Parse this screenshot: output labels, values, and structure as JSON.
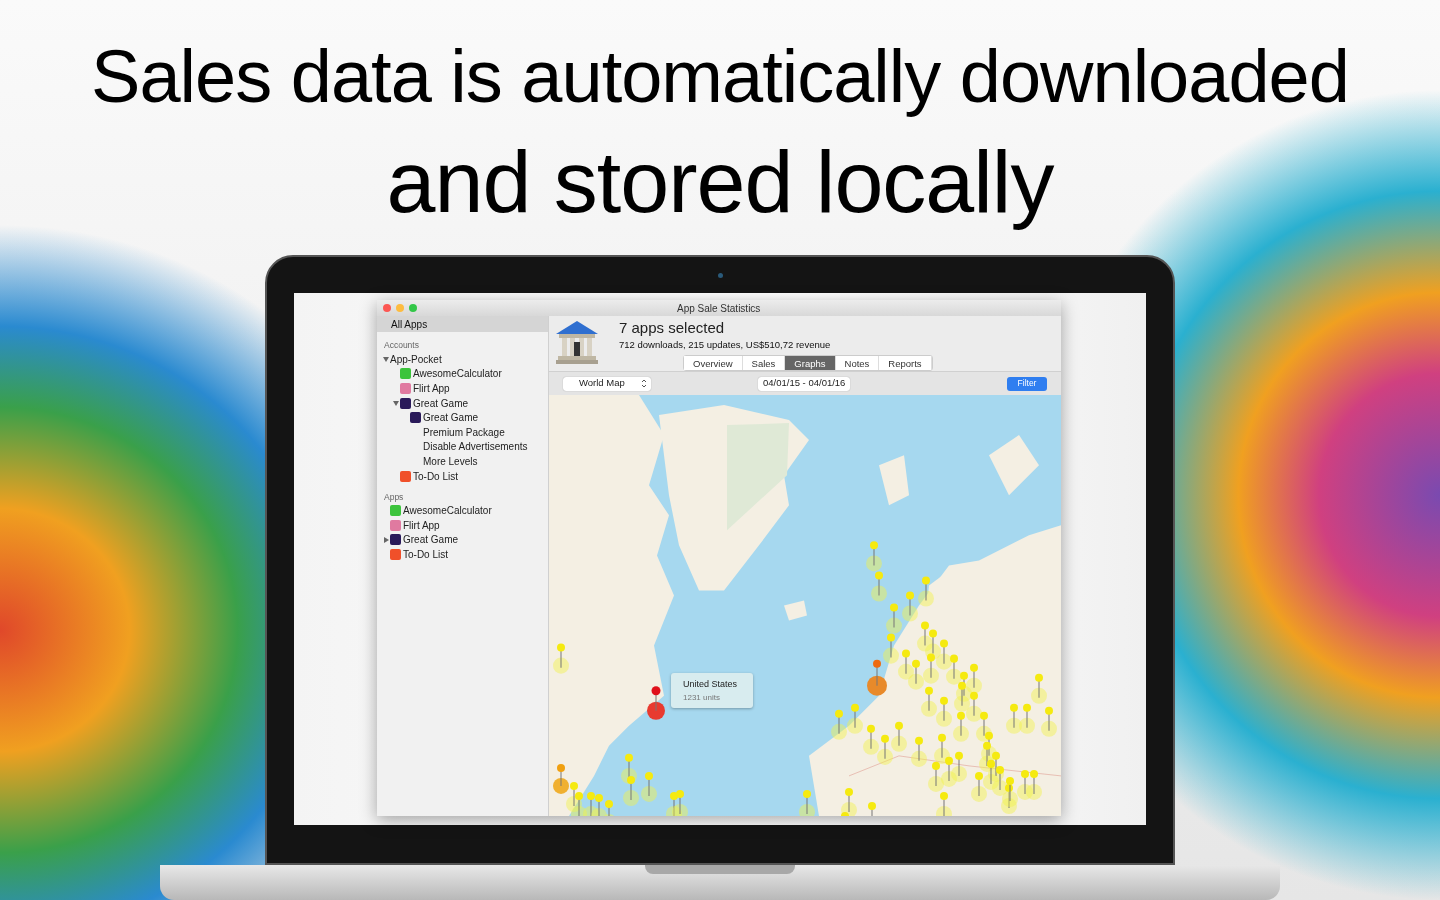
{
  "headline": [
    "Sales data is automatically downloaded",
    "and stored locally"
  ],
  "window": {
    "title": "App Sale Statistics"
  },
  "sidebar": {
    "header": "All Apps",
    "sections": [
      {
        "title": "Accounts",
        "items": [
          {
            "label": "App-Pocket",
            "kind": "account",
            "expanded": true,
            "children": [
              {
                "label": "AwesomeCalculator",
                "kind": "calculator"
              },
              {
                "label": "Flirt App",
                "kind": "heart"
              },
              {
                "label": "Great Game",
                "kind": "game",
                "expanded": true,
                "children": [
                  {
                    "label": "Great Game",
                    "kind": "game"
                  },
                  {
                    "label": "Premium Package",
                    "kind": "purchase"
                  },
                  {
                    "label": "Disable Advertisements",
                    "kind": "purchase"
                  },
                  {
                    "label": "More Levels",
                    "kind": "purchase"
                  }
                ]
              },
              {
                "label": "To-Do List",
                "kind": "chart"
              }
            ]
          }
        ]
      },
      {
        "title": "Apps",
        "items": [
          {
            "label": "AwesomeCalculator",
            "kind": "calculator"
          },
          {
            "label": "Flirt App",
            "kind": "heart"
          },
          {
            "label": "Great Game",
            "kind": "game",
            "expanded": false
          },
          {
            "label": "To-Do List",
            "kind": "chart"
          }
        ]
      }
    ]
  },
  "summary": {
    "title": "7 apps selected",
    "subtitle": "712 downloads, 215 updates, US$510,72 revenue"
  },
  "tabs": [
    {
      "label": "Overview",
      "selected": false
    },
    {
      "label": "Sales",
      "selected": false
    },
    {
      "label": "Graphs",
      "selected": true
    },
    {
      "label": "Notes",
      "selected": false
    },
    {
      "label": "Reports",
      "selected": false
    }
  ],
  "toolbar": {
    "map_select": "World Map",
    "date_range": "04/01/15 - 04/01/16",
    "filter_button": "Filter"
  },
  "map": {
    "tooltip": {
      "title": "United States",
      "subtitle": "1231 units"
    }
  }
}
